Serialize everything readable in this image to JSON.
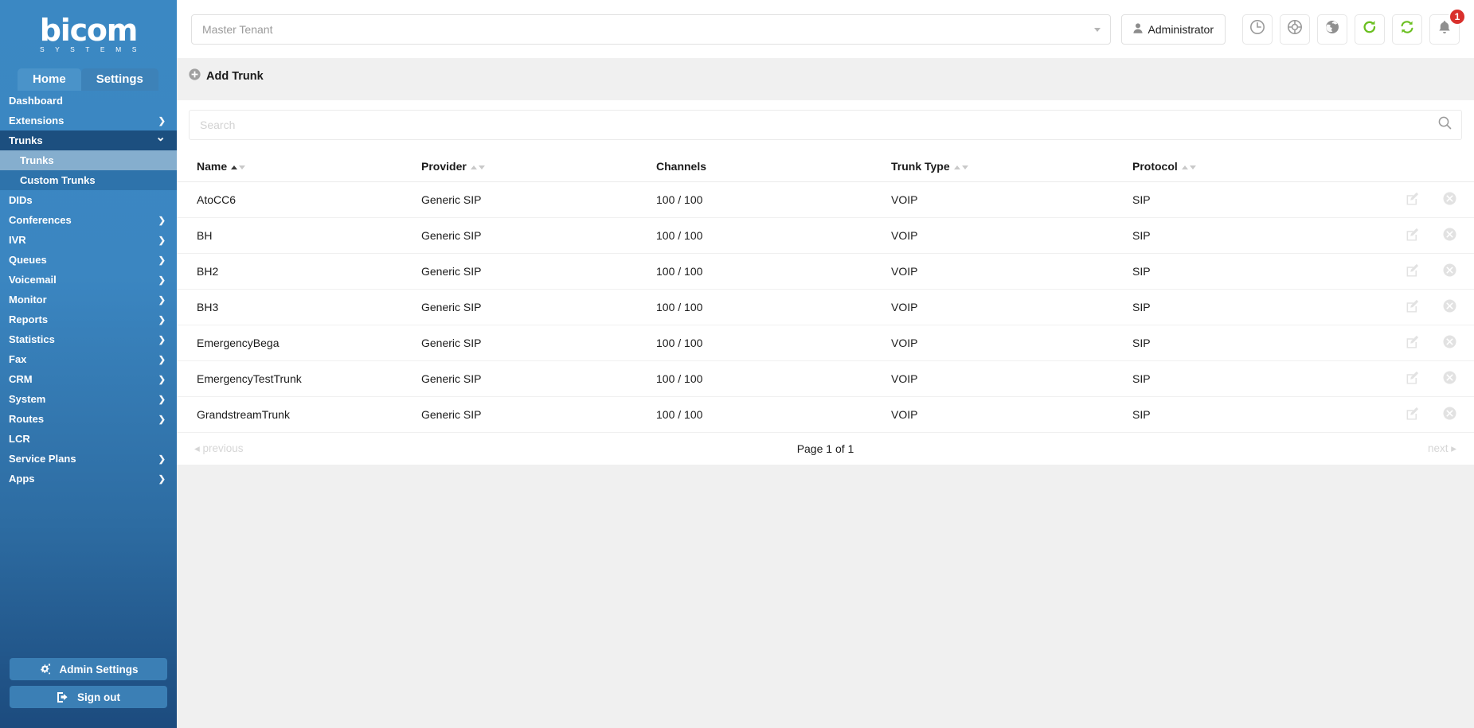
{
  "brand": {
    "name": "bicom",
    "subtitle": "S Y S T E M S",
    "accent": "#3b88c3",
    "sidebar_active": "#85aece",
    "badge_color": "#d9302c",
    "refresh_green": "#6abf20"
  },
  "sidebar": {
    "tabs": [
      {
        "label": "Home",
        "active": true
      },
      {
        "label": "Settings",
        "active": false
      }
    ],
    "items": [
      {
        "label": "Dashboard",
        "chevron": "none",
        "state": "normal"
      },
      {
        "label": "Extensions",
        "chevron": "chevron-right",
        "state": "normal"
      },
      {
        "label": "Trunks",
        "chevron": "chevron-down",
        "state": "expanded"
      },
      {
        "label": "Trunks",
        "chevron": "none",
        "state": "sub-active"
      },
      {
        "label": "Custom Trunks",
        "chevron": "none",
        "state": "sub"
      },
      {
        "label": "DIDs",
        "chevron": "none",
        "state": "normal"
      },
      {
        "label": "Conferences",
        "chevron": "chevron-right",
        "state": "normal"
      },
      {
        "label": "IVR",
        "chevron": "chevron-right",
        "state": "normal"
      },
      {
        "label": "Queues",
        "chevron": "chevron-right",
        "state": "normal"
      },
      {
        "label": "Voicemail",
        "chevron": "chevron-right",
        "state": "normal"
      },
      {
        "label": "Monitor",
        "chevron": "chevron-right",
        "state": "normal"
      },
      {
        "label": "Reports",
        "chevron": "chevron-right",
        "state": "normal"
      },
      {
        "label": "Statistics",
        "chevron": "chevron-right",
        "state": "normal"
      },
      {
        "label": "Fax",
        "chevron": "chevron-right",
        "state": "normal"
      },
      {
        "label": "CRM",
        "chevron": "chevron-right",
        "state": "normal"
      },
      {
        "label": "System",
        "chevron": "chevron-right",
        "state": "normal"
      },
      {
        "label": "Routes",
        "chevron": "chevron-right",
        "state": "normal"
      },
      {
        "label": "LCR",
        "chevron": "none",
        "state": "normal"
      },
      {
        "label": "Service Plans",
        "chevron": "chevron-right",
        "state": "normal"
      },
      {
        "label": "Apps",
        "chevron": "chevron-right",
        "state": "normal"
      }
    ],
    "admin_settings_label": "Admin Settings",
    "sign_out_label": "Sign out"
  },
  "header": {
    "tenant": {
      "value": "Master Tenant",
      "placeholder": "Master Tenant"
    },
    "user_label": "Administrator",
    "icons": [
      {
        "name": "clock-icon"
      },
      {
        "name": "lifebuoy-icon"
      },
      {
        "name": "globe-icon"
      },
      {
        "name": "refresh-icon"
      },
      {
        "name": "sync-icon"
      },
      {
        "name": "bell-icon",
        "badge": "1"
      }
    ]
  },
  "toolbar": {
    "add_trunk_label": "Add Trunk"
  },
  "search": {
    "value": "",
    "placeholder": "Search"
  },
  "table": {
    "columns": [
      {
        "label": "Name",
        "sort": "asc"
      },
      {
        "label": "Provider",
        "sort": "none"
      },
      {
        "label": "Channels",
        "sort": "off"
      },
      {
        "label": "Trunk Type",
        "sort": "none"
      },
      {
        "label": "Protocol",
        "sort": "none"
      },
      {
        "label": "",
        "sort": "off"
      }
    ],
    "rows": [
      {
        "name": "AtoCC6",
        "provider": "Generic SIP",
        "channels": "100 / 100",
        "trunk_type": "VOIP",
        "protocol": "SIP"
      },
      {
        "name": "BH",
        "provider": "Generic SIP",
        "channels": "100 / 100",
        "trunk_type": "VOIP",
        "protocol": "SIP"
      },
      {
        "name": "BH2",
        "provider": "Generic SIP",
        "channels": "100 / 100",
        "trunk_type": "VOIP",
        "protocol": "SIP"
      },
      {
        "name": "BH3",
        "provider": "Generic SIP",
        "channels": "100 / 100",
        "trunk_type": "VOIP",
        "protocol": "SIP"
      },
      {
        "name": "EmergencyBega",
        "provider": "Generic SIP",
        "channels": "100 / 100",
        "trunk_type": "VOIP",
        "protocol": "SIP"
      },
      {
        "name": "EmergencyTestTrunk",
        "provider": "Generic SIP",
        "channels": "100 / 100",
        "trunk_type": "VOIP",
        "protocol": "SIP"
      },
      {
        "name": "GrandstreamTrunk",
        "provider": "Generic SIP",
        "channels": "100 / 100",
        "trunk_type": "VOIP",
        "protocol": "SIP"
      }
    ]
  },
  "pagination": {
    "previous_label": "previous",
    "page_info": "Page 1 of 1",
    "next_label": "next"
  }
}
